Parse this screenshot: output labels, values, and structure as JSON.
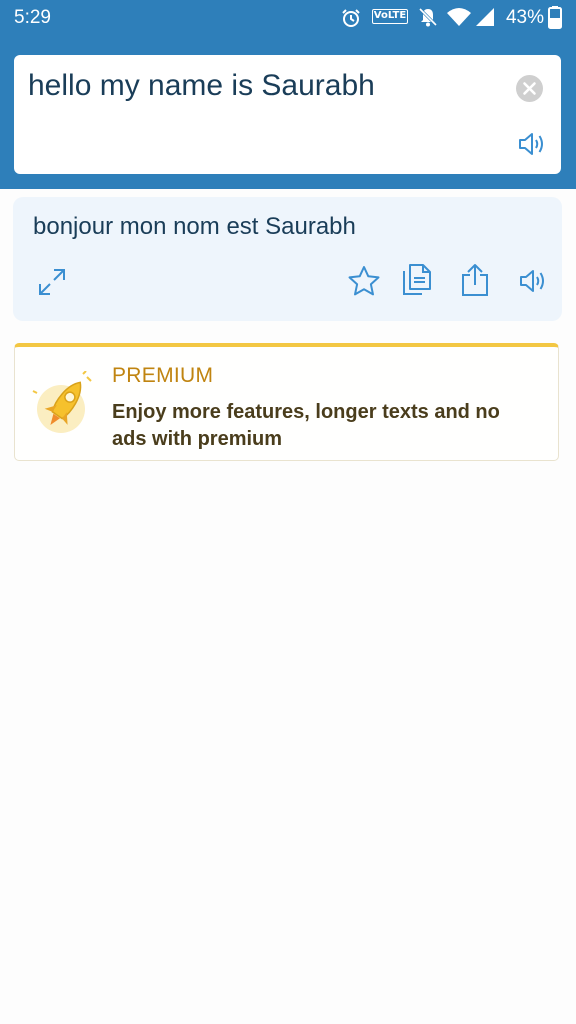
{
  "status_bar": {
    "time": "5:29",
    "volte_label": "VoLTE",
    "battery_percent": "43%",
    "icons": [
      "alarm-icon",
      "volte-icon",
      "notifications-off-icon",
      "wifi-icon",
      "signal-icon",
      "battery-icon"
    ]
  },
  "input": {
    "text": "hello my name is Saurabh",
    "icons": [
      "clear-icon",
      "speaker-icon"
    ]
  },
  "translation": {
    "text": "bonjour mon nom est Saurabh",
    "actions": [
      "expand-icon",
      "star-icon",
      "copy-icon",
      "share-icon",
      "speaker-icon"
    ]
  },
  "premium": {
    "label": "PREMIUM",
    "description": "Enjoy more features, longer texts and no ads with premium",
    "icon": "rocket-icon"
  },
  "colors": {
    "header_blue": "#2e7fba",
    "accent_icon_blue": "#3b8fd1",
    "premium_gold": "#f3c743",
    "premium_label": "#c08410"
  }
}
